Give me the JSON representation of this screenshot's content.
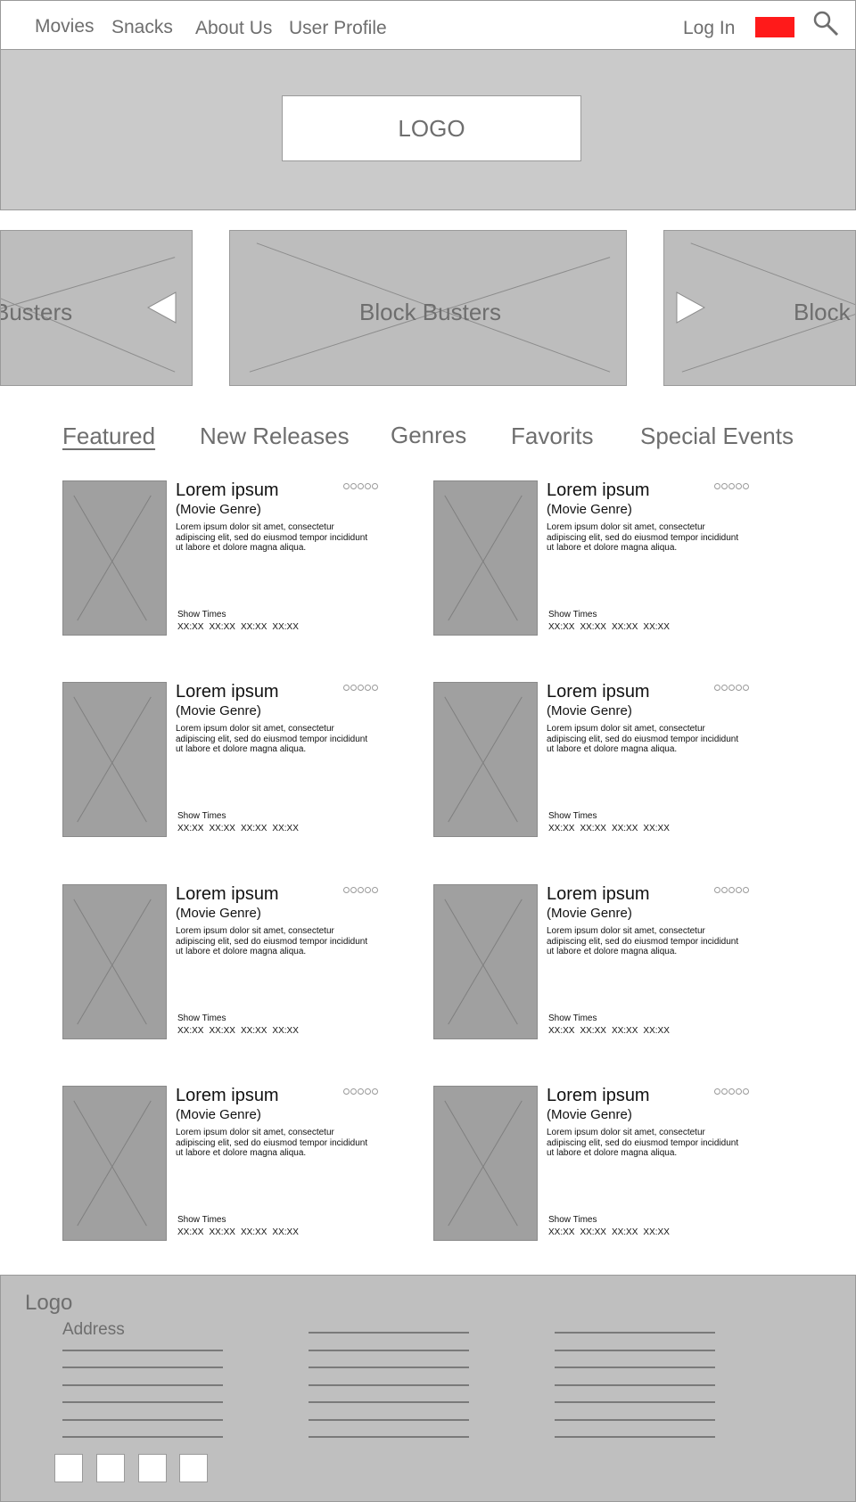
{
  "nav": {
    "items": [
      "Movies",
      "Snacks",
      "About Us",
      "User Profile"
    ],
    "login": "Log In",
    "language_color": "#ff1a1a",
    "search_icon": "search-icon"
  },
  "hero": {
    "logo": "LOGO"
  },
  "carousel": {
    "slides": [
      "Block Busters",
      "Block Busters",
      "Block Busters"
    ],
    "visible_text": {
      "left": "Busters",
      "center": "Block Busters",
      "right": "Block"
    }
  },
  "tabs": [
    "Featured",
    "New Releases",
    "Genres",
    "Favorits",
    "Special Events"
  ],
  "movies": [
    {
      "title": "Lorem ipsum",
      "genre": "(Movie Genre)",
      "desc": "Lorem ipsum dolor sit amet, consectetur adipiscing elit, sed do eiusmod tempor incididunt ut labore et dolore magna aliqua.",
      "showtimes_label": "Show Times",
      "times": [
        "XX:XX",
        "XX:XX",
        "XX:XX",
        "XX:XX"
      ],
      "rating": 0
    },
    {
      "title": "Lorem ipsum",
      "genre": "(Movie Genre)",
      "desc": "Lorem ipsum dolor sit amet, consectetur adipiscing elit, sed do eiusmod tempor incididunt ut labore et dolore magna aliqua.",
      "showtimes_label": "Show Times",
      "times": [
        "XX:XX",
        "XX:XX",
        "XX:XX",
        "XX:XX"
      ],
      "rating": 0
    },
    {
      "title": "Lorem ipsum",
      "genre": "(Movie Genre)",
      "desc": "Lorem ipsum dolor sit amet, consectetur adipiscing elit, sed do eiusmod tempor incididunt ut labore et dolore magna aliqua.",
      "showtimes_label": "Show Times",
      "times": [
        "XX:XX",
        "XX:XX",
        "XX:XX",
        "XX:XX"
      ],
      "rating": 0
    },
    {
      "title": "Lorem ipsum",
      "genre": "(Movie Genre)",
      "desc": "Lorem ipsum dolor sit amet, consectetur adipiscing elit, sed do eiusmod tempor incididunt ut labore et dolore magna aliqua.",
      "showtimes_label": "Show Times",
      "times": [
        "XX:XX",
        "XX:XX",
        "XX:XX",
        "XX:XX"
      ],
      "rating": 0
    },
    {
      "title": "Lorem ipsum",
      "genre": "(Movie Genre)",
      "desc": "Lorem ipsum dolor sit amet, consectetur adipiscing elit, sed do eiusmod tempor incididunt ut labore et dolore magna aliqua.",
      "showtimes_label": "Show Times",
      "times": [
        "XX:XX",
        "XX:XX",
        "XX:XX",
        "XX:XX"
      ],
      "rating": 0
    },
    {
      "title": "Lorem ipsum",
      "genre": "(Movie Genre)",
      "desc": "Lorem ipsum dolor sit amet, consectetur adipiscing elit, sed do eiusmod tempor incididunt ut labore et dolore magna aliqua.",
      "showtimes_label": "Show Times",
      "times": [
        "XX:XX",
        "XX:XX",
        "XX:XX",
        "XX:XX"
      ],
      "rating": 0
    },
    {
      "title": "Lorem ipsum",
      "genre": "(Movie Genre)",
      "desc": "Lorem ipsum dolor sit amet, consectetur adipiscing elit, sed do eiusmod tempor incididunt ut labore et dolore magna aliqua.",
      "showtimes_label": "Show Times",
      "times": [
        "XX:XX",
        "XX:XX",
        "XX:XX",
        "XX:XX"
      ],
      "rating": 0
    },
    {
      "title": "Lorem ipsum",
      "genre": "(Movie Genre)",
      "desc": "Lorem ipsum dolor sit amet, consectetur adipiscing elit, sed do eiusmod tempor incididunt ut labore et dolore magna aliqua.",
      "showtimes_label": "Show Times",
      "times": [
        "XX:XX",
        "XX:XX",
        "XX:XX",
        "XX:XX"
      ],
      "rating": 0
    }
  ],
  "footer": {
    "logo": "Logo",
    "address": "Address"
  }
}
